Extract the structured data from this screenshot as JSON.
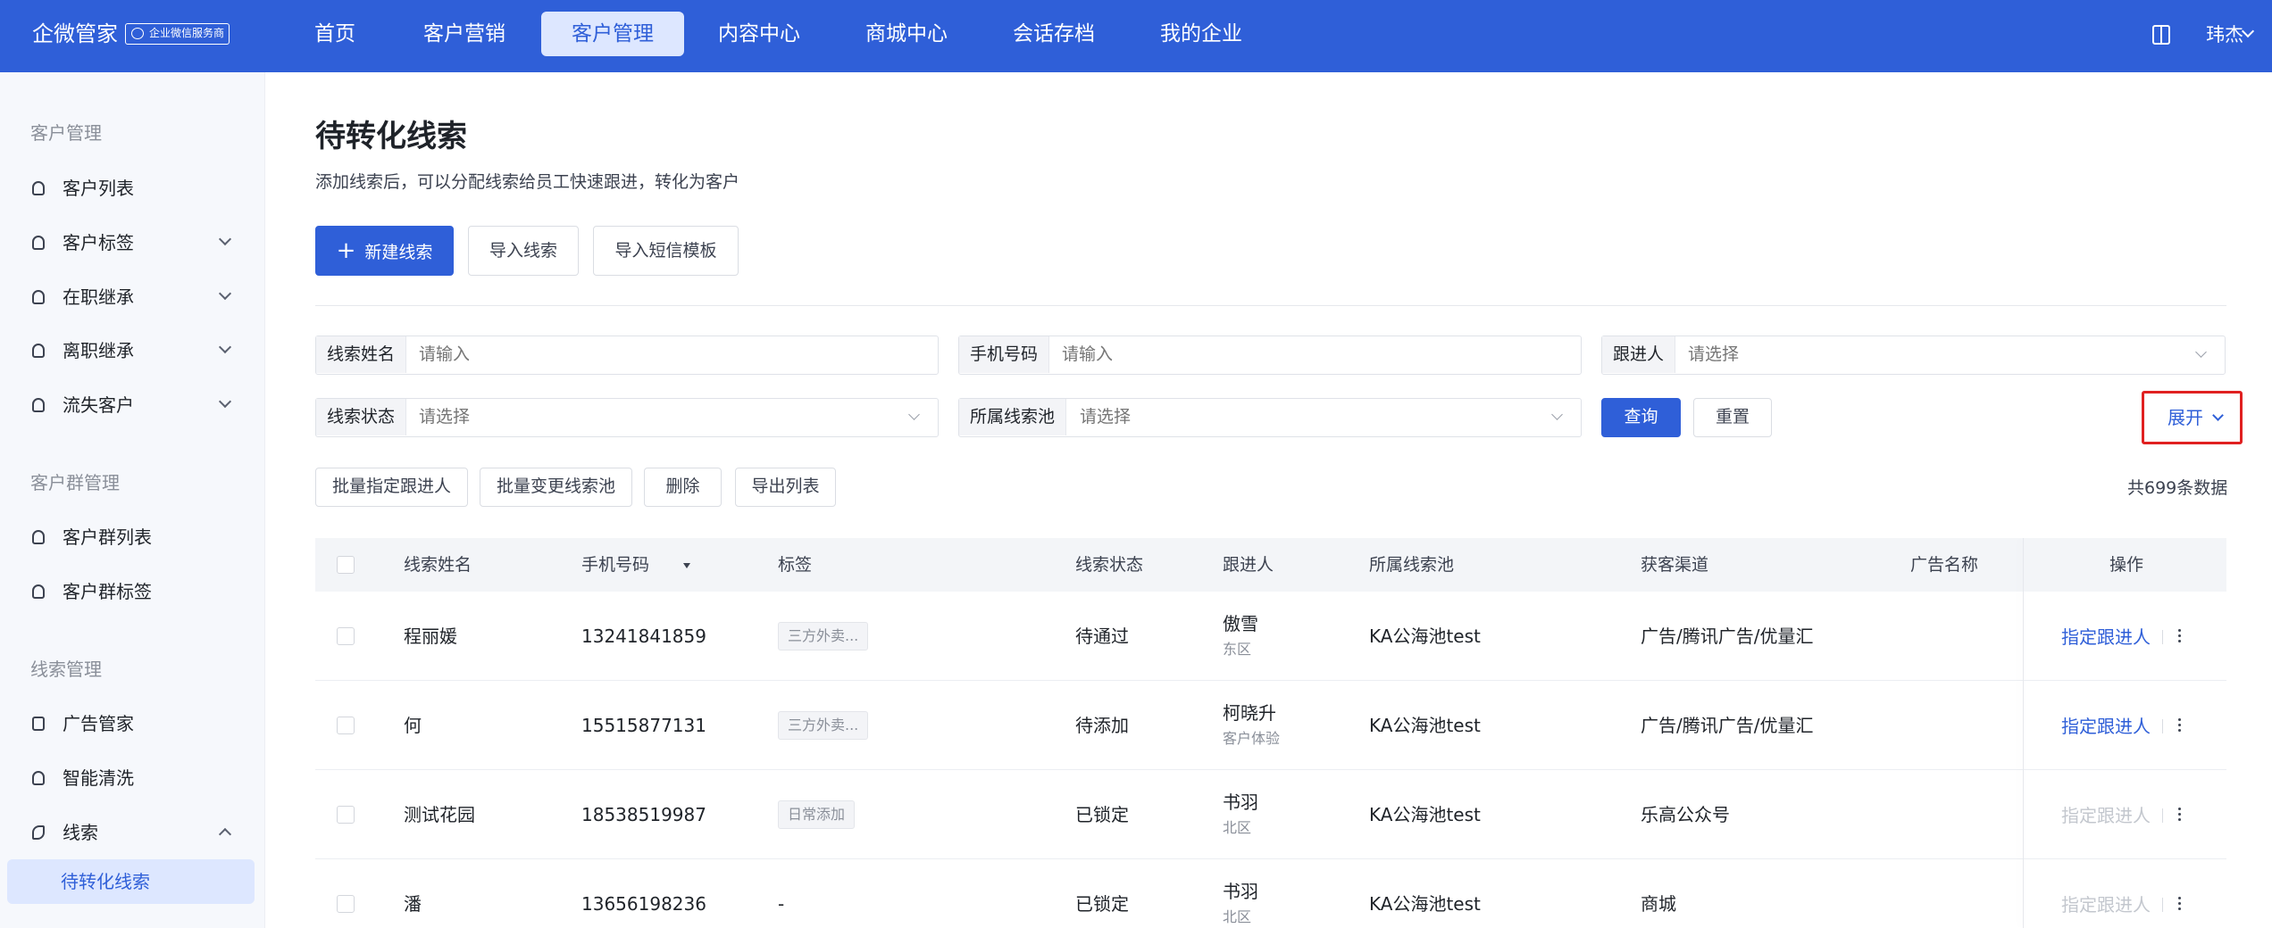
{
  "topbar": {
    "brand": "企微管家",
    "badge": "企业微信服务商",
    "nav": [
      {
        "label": "首页",
        "active": false
      },
      {
        "label": "客户营销",
        "active": false
      },
      {
        "label": "客户管理",
        "active": true
      },
      {
        "label": "内容中心",
        "active": false
      },
      {
        "label": "商城中心",
        "active": false
      },
      {
        "label": "会话存档",
        "active": false
      },
      {
        "label": "我的企业",
        "active": false
      }
    ],
    "user": "玮杰"
  },
  "sidebar": {
    "group1": "客户管理",
    "group1_items": [
      {
        "label": "客户列表",
        "icon": "user-icon",
        "caret": false
      },
      {
        "label": "客户标签",
        "icon": "user-tag-icon",
        "caret": true
      },
      {
        "label": "在职继承",
        "icon": "transfer-in-icon",
        "caret": true
      },
      {
        "label": "离职继承",
        "icon": "transfer-out-icon",
        "caret": true
      },
      {
        "label": "流失客户",
        "icon": "user-lost-icon",
        "caret": true
      }
    ],
    "group2": "客户群管理",
    "group2_items": [
      {
        "label": "客户群列表",
        "icon": "group-icon"
      },
      {
        "label": "客户群标签",
        "icon": "group-tag-icon"
      }
    ],
    "group3": "线索管理",
    "group3_items": [
      {
        "label": "广告管家",
        "icon": "ad-icon"
      },
      {
        "label": "智能清洗",
        "icon": "clean-icon"
      },
      {
        "label": "线索",
        "icon": "lead-icon",
        "expanded": true
      },
      {
        "label": "待转化线索",
        "active": true
      }
    ]
  },
  "main": {
    "title": "待转化线索",
    "description": "添加线索后，可以分配线索给员工快速跟进，转化为客户",
    "actions": {
      "new_lead": "新建线索",
      "import_leads": "导入线索",
      "import_sms_template": "导入短信模板"
    },
    "filters": {
      "lead_name": {
        "label": "线索姓名",
        "placeholder": "请输入"
      },
      "phone": {
        "label": "手机号码",
        "placeholder": "请输入"
      },
      "follower": {
        "label": "跟进人",
        "placeholder": "请选择"
      },
      "status": {
        "label": "线索状态",
        "placeholder": "请选择"
      },
      "pool": {
        "label": "所属线索池",
        "placeholder": "请选择"
      },
      "query": "查询",
      "reset": "重置",
      "expand": "展开"
    },
    "bulk": {
      "assign_follower": "批量指定跟进人",
      "change_pool": "批量变更线索池",
      "delete": "删除",
      "export": "导出列表"
    },
    "total": "共699条数据"
  },
  "table": {
    "columns": [
      "线索姓名",
      "手机号码",
      "标签",
      "线索状态",
      "跟进人",
      "所属线索池",
      "获客渠道",
      "广告名称",
      "操作"
    ],
    "rows": [
      {
        "name": "程丽媛",
        "phone": "13241841859",
        "tag": "三方外卖...",
        "status": "待通过",
        "follower": "傲雪",
        "follower_sub": "东区",
        "pool": "KA公海池test",
        "channel": "广告/腾讯广告/优量汇",
        "op": "指定跟进人",
        "op_enabled": true
      },
      {
        "name": "何",
        "phone": "15515877131",
        "tag": "三方外卖...",
        "status": "待添加",
        "follower": "柯晓升",
        "follower_sub": "客户体验",
        "pool": "KA公海池test",
        "channel": "广告/腾讯广告/优量汇",
        "op": "指定跟进人",
        "op_enabled": true
      },
      {
        "name": "测试花园",
        "phone": "18538519987",
        "tag": "日常添加",
        "status": "已锁定",
        "follower": "书羽",
        "follower_sub": "北区",
        "pool": "KA公海池test",
        "channel": "乐高公众号",
        "op": "指定跟进人",
        "op_enabled": false
      },
      {
        "name": "潘",
        "phone": "13656198236",
        "tag": "-",
        "status": "已锁定",
        "follower": "书羽",
        "follower_sub": "北区",
        "pool": "KA公海池test",
        "channel": "商城",
        "op": "指定跟进人",
        "op_enabled": false
      }
    ]
  },
  "colors": {
    "primary": "#2f5fd8",
    "highlight_border": "#e02020"
  }
}
